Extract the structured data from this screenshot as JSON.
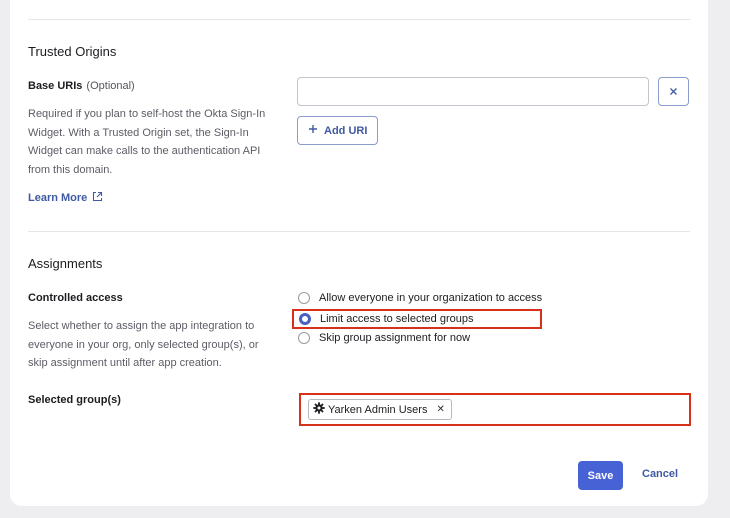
{
  "trusted_origins": {
    "title": "Trusted Origins",
    "base_uris_label": "Base URIs",
    "base_uris_optional": "(Optional)",
    "help_text": "Required if you plan to self-host the Okta Sign-In Widget. With a Trusted Origin set, the Sign-In Widget can make calls to the authentication API from this domain.",
    "learn_more": "Learn More",
    "uri_input_value": "",
    "add_uri_label": "Add URI"
  },
  "assignments": {
    "title": "Assignments",
    "controlled_access_label": "Controlled access",
    "controlled_access_help": "Select whether to assign the app integration to everyone in your org, only selected group(s), or skip assignment until after app creation.",
    "options": [
      {
        "label": "Allow everyone in your organization to access",
        "selected": false
      },
      {
        "label": "Limit access to selected groups",
        "selected": true
      },
      {
        "label": "Skip group assignment for now",
        "selected": false
      }
    ],
    "selected_groups_label": "Selected group(s)",
    "groups": [
      {
        "name": "Yarken Admin Users"
      }
    ]
  },
  "footer": {
    "save_label": "Save",
    "cancel_label": "Cancel"
  },
  "colors": {
    "primary": "#4662d5",
    "link": "#3f59a4",
    "highlight": "#d7301b"
  }
}
